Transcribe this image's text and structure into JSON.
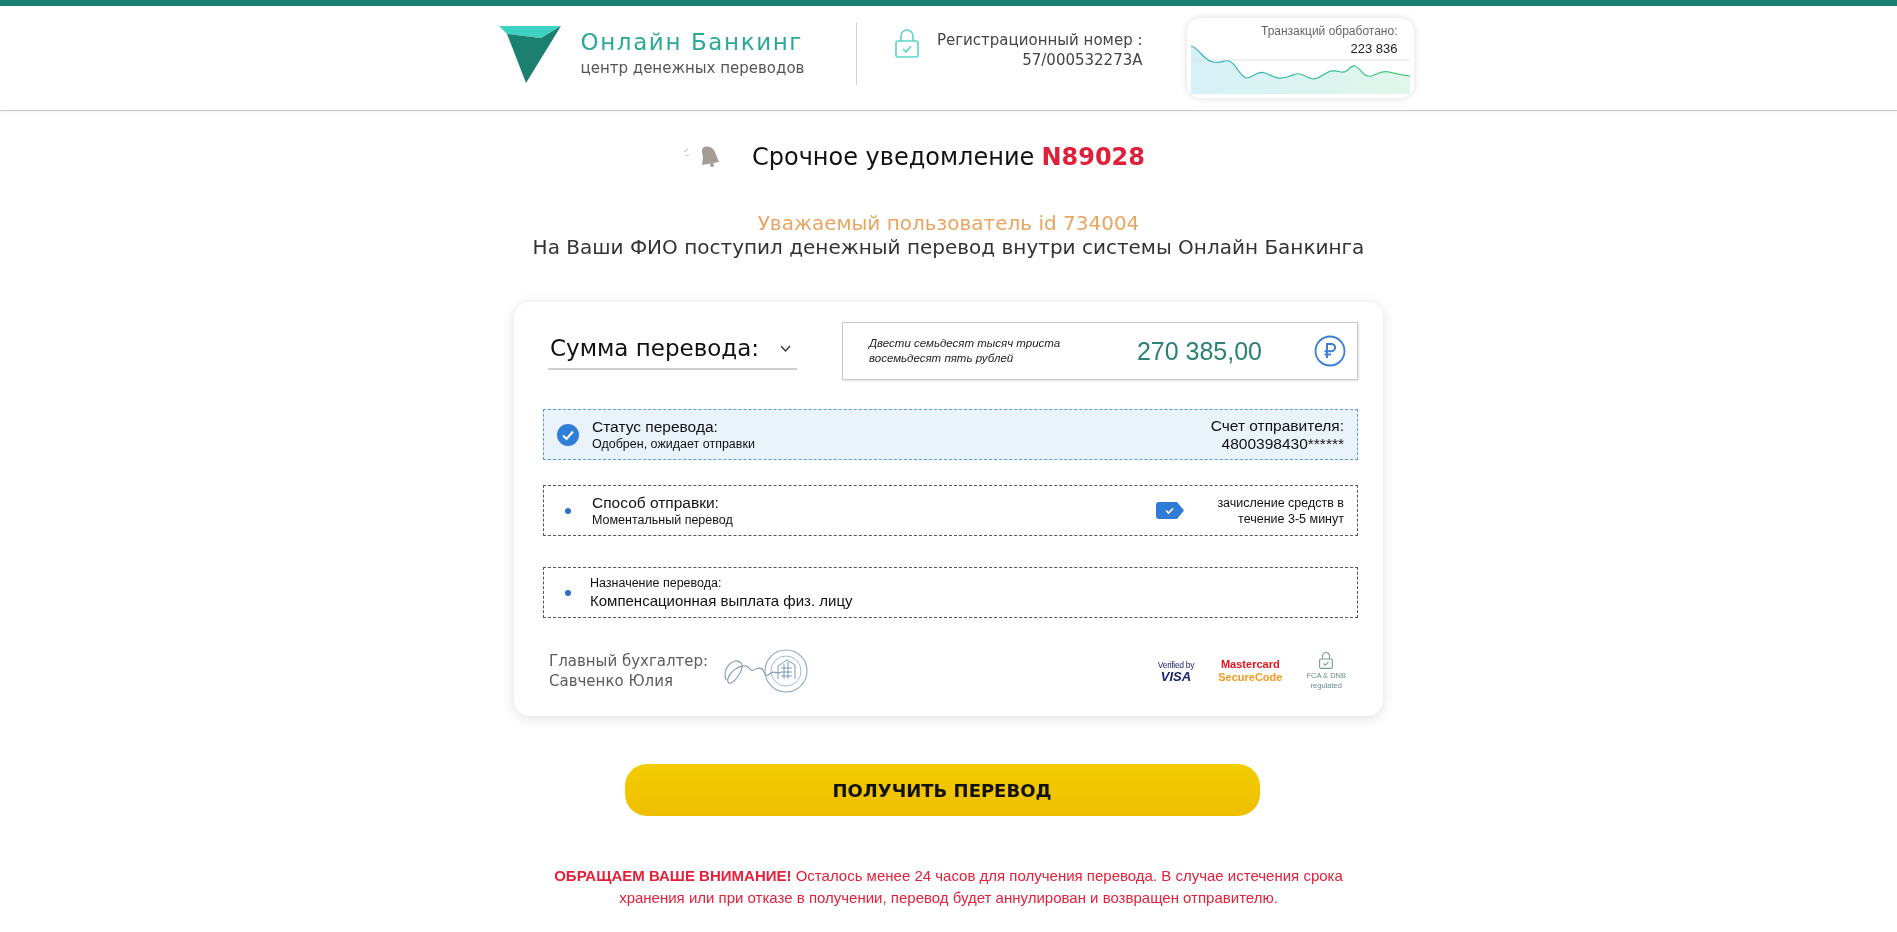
{
  "header": {
    "brand": {
      "name": "Онлайн Банкинг",
      "tagline": "центр денежных переводов"
    },
    "registration": {
      "label": "Регистрационный номер :",
      "number": "57/000532273A"
    },
    "transactions": {
      "label": "Транзакций обработано:",
      "count": "223 836"
    }
  },
  "notice": {
    "title": "Срочное уведомление",
    "number": "N89028",
    "greeting": "Уважаемый пользователь id 734004",
    "message": "На Ваши ФИО поступил денежный перевод внутри системы Онлайн Банкинга"
  },
  "transfer": {
    "amount_select": "Сумма перевода:",
    "amount": {
      "in_words": "Двести семьдесят тысяч триста восемьдесят пять рублей",
      "value": "270 385,00"
    },
    "rows": [
      {
        "kind": "status",
        "label": "Статус перевода:",
        "value": "Одобрен, ожидает отправки",
        "aside_label": "Счет отправителя:",
        "aside_value": "4800398430******"
      },
      {
        "kind": "method",
        "label": "Способ отправки:",
        "value": "Моментальный перевод",
        "note": "зачисление средств в течение 3-5 минут"
      },
      {
        "kind": "purpose",
        "label": "Назначение перевода:",
        "value": "Компенсационная выплата физ. лицу"
      }
    ],
    "accountant": {
      "title": "Главный бухгалтер:",
      "name": "Савченко Юлия"
    },
    "badges": [
      {
        "kind": "visa",
        "lines": [
          "Verified by",
          "VISA"
        ]
      },
      {
        "kind": "mastercard",
        "lines": [
          "Mastercard",
          "SecureCode"
        ]
      },
      {
        "kind": "regulator",
        "lines": [
          "FCA & DNB",
          "regulated"
        ]
      }
    ]
  },
  "action_button": "ПОЛУЧИТЬ ПЕРЕВОД",
  "warning": "**ОБРАЩАЕМ ВАШЕ ВНИМАНИЕ!** Осталось менее 24 часов для получения перевода. В случае истечения срока хранения или при отказе в получении, перевод будет аннулирован и возвращен отправителю."
}
